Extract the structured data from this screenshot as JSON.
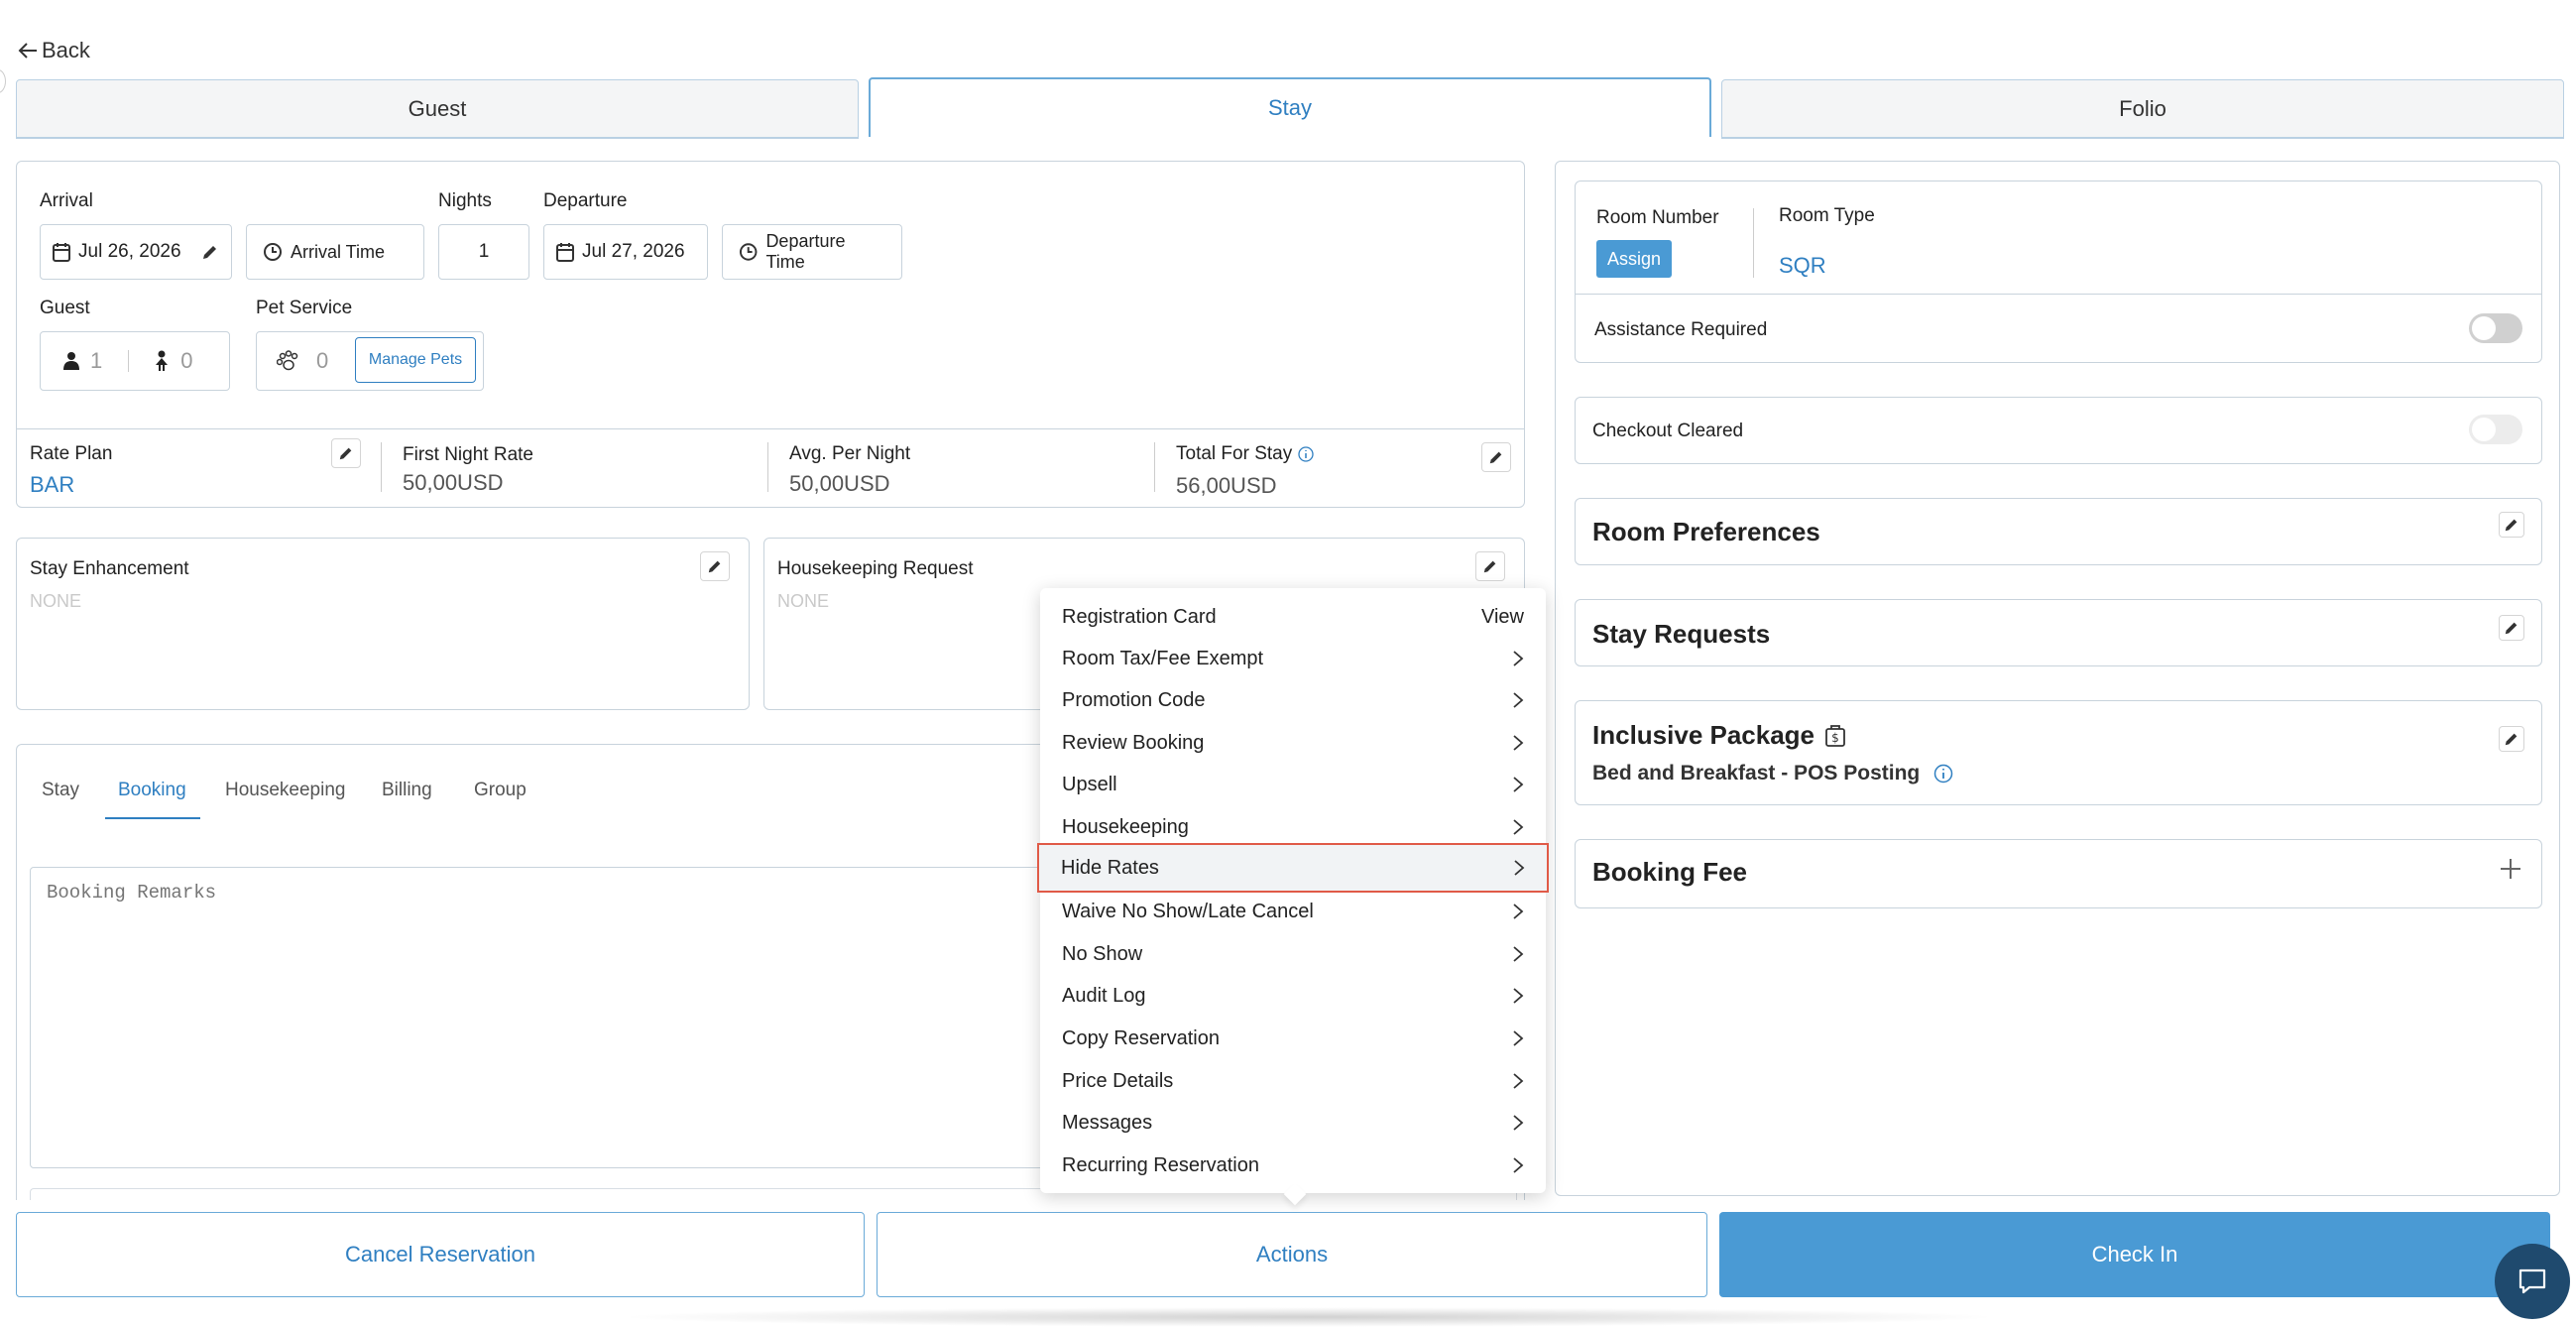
{
  "nav": {
    "back_label": "Back"
  },
  "tabs": [
    {
      "label": "Guest"
    },
    {
      "label": "Stay"
    },
    {
      "label": "Folio"
    }
  ],
  "stay": {
    "arrival_label": "Arrival",
    "arrival_date": "Jul 26, 2026",
    "arrival_time_label": "Arrival Time",
    "nights_label": "Nights",
    "nights_value": "1",
    "departure_label": "Departure",
    "departure_date": "Jul 27, 2026",
    "departure_time_label": "Departure Time",
    "guest_label": "Guest",
    "adults": "1",
    "children": "0",
    "pet_service_label": "Pet Service",
    "pets": "0",
    "manage_pets_label": "Manage Pets"
  },
  "rates": {
    "rate_plan_label": "Rate Plan",
    "rate_plan_value": "BAR",
    "first_night_label": "First Night Rate",
    "first_night_value": "50,00USD",
    "avg_label": "Avg. Per Night",
    "avg_value": "50,00USD",
    "total_label": "Total For Stay",
    "total_value": "56,00USD"
  },
  "enhancement": {
    "stay_enh_label": "Stay Enhancement",
    "stay_enh_value": "NONE",
    "housekeeping_label": "Housekeeping Request",
    "housekeeping_value": "NONE"
  },
  "subtabs": [
    {
      "label": "Stay"
    },
    {
      "label": "Booking"
    },
    {
      "label": "Housekeeping"
    },
    {
      "label": "Billing"
    },
    {
      "label": "Group"
    }
  ],
  "remarks_placeholder": "Booking Remarks",
  "menu": {
    "items": [
      {
        "label": "Registration Card",
        "trail": "View"
      },
      {
        "label": "Room Tax/Fee Exempt"
      },
      {
        "label": "Promotion Code"
      },
      {
        "label": "Review Booking"
      },
      {
        "label": "Upsell"
      },
      {
        "label": "Housekeeping"
      },
      {
        "label": "Hide Rates"
      },
      {
        "label": "Waive No Show/Late Cancel"
      },
      {
        "label": "No Show"
      },
      {
        "label": "Audit Log"
      },
      {
        "label": "Copy Reservation"
      },
      {
        "label": "Price Details"
      },
      {
        "label": "Messages"
      },
      {
        "label": "Recurring Reservation"
      }
    ]
  },
  "room": {
    "room_number_label": "Room Number",
    "assign_label": "Assign",
    "room_type_label": "Room Type",
    "room_type_value": "SQR",
    "assistance_label": "Assistance Required",
    "checkout_label": "Checkout Cleared",
    "preferences_label": "Room Preferences",
    "stay_requests_label": "Stay Requests",
    "inclusive_label": "Inclusive Package",
    "inclusive_value": "Bed and Breakfast - POS Posting",
    "booking_fee_label": "Booking Fee"
  },
  "footer": {
    "cancel_label": "Cancel Reservation",
    "actions_label": "Actions",
    "checkin_label": "Check In"
  },
  "colors": {
    "accent": "#2f7fc1",
    "checkin_bg": "#4a9ad4",
    "highlight_border": "#e05a47",
    "chat_bg": "#1f4a6e"
  }
}
